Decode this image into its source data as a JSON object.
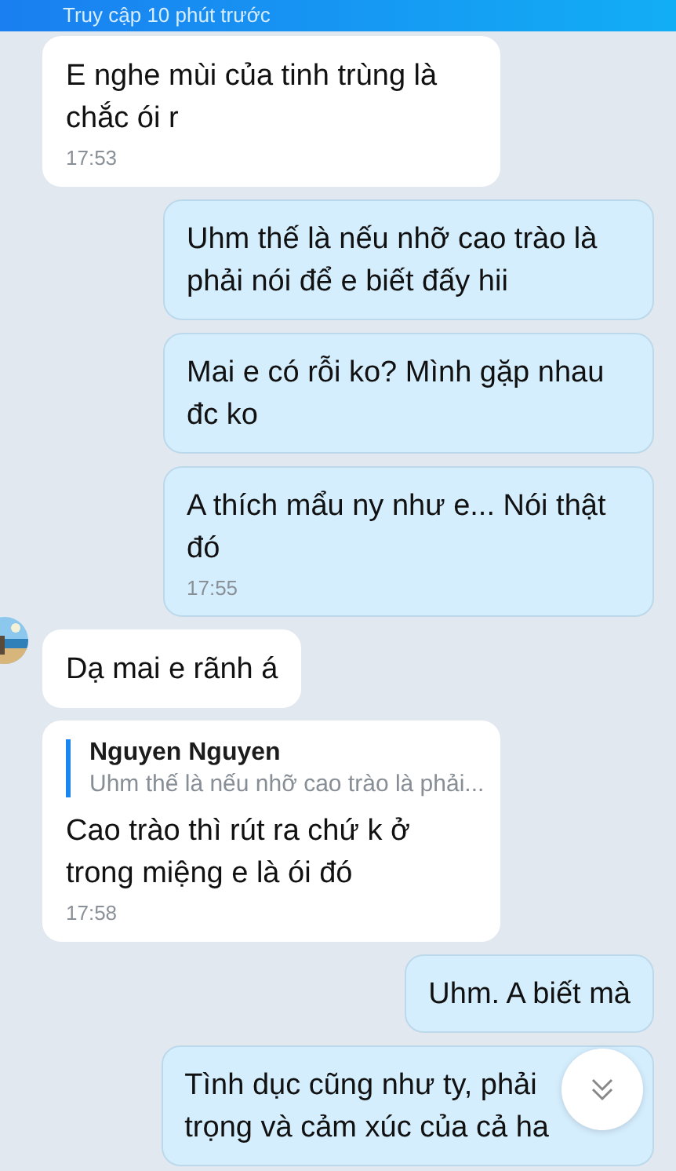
{
  "header": {
    "status": "Truy cập 10 phút trước"
  },
  "messages": [
    {
      "kind": "incoming",
      "text": "E nghe mùi của tinh trùng là chắc ói r",
      "time": "17:53"
    },
    {
      "kind": "outgoing",
      "text": "Uhm thế là nếu nhỡ cao trào là phải nói để e biết đấy hii"
    },
    {
      "kind": "outgoing",
      "text": "Mai e có rỗi ko? Mình gặp nhau đc ko"
    },
    {
      "kind": "outgoing",
      "text": "A thích mẩu ny như e... Nói thật đó",
      "time": "17:55"
    },
    {
      "kind": "incoming",
      "avatar": true,
      "text": "Dạ mai e rãnh á"
    },
    {
      "kind": "incoming",
      "quote": {
        "author": "Nguyen Nguyen",
        "text": "Uhm thế là nếu nhỡ cao trào là phải..."
      },
      "text": "Cao trào thì rút ra chứ k ở trong miệng e là ói đó",
      "time": "17:58"
    },
    {
      "kind": "outgoing",
      "text": "Uhm. A biết mà"
    },
    {
      "kind": "outgoing",
      "lines": [
        "Tình dục cũng như ty, phải",
        "trọng và cảm xúc của cả ha"
      ]
    }
  ]
}
